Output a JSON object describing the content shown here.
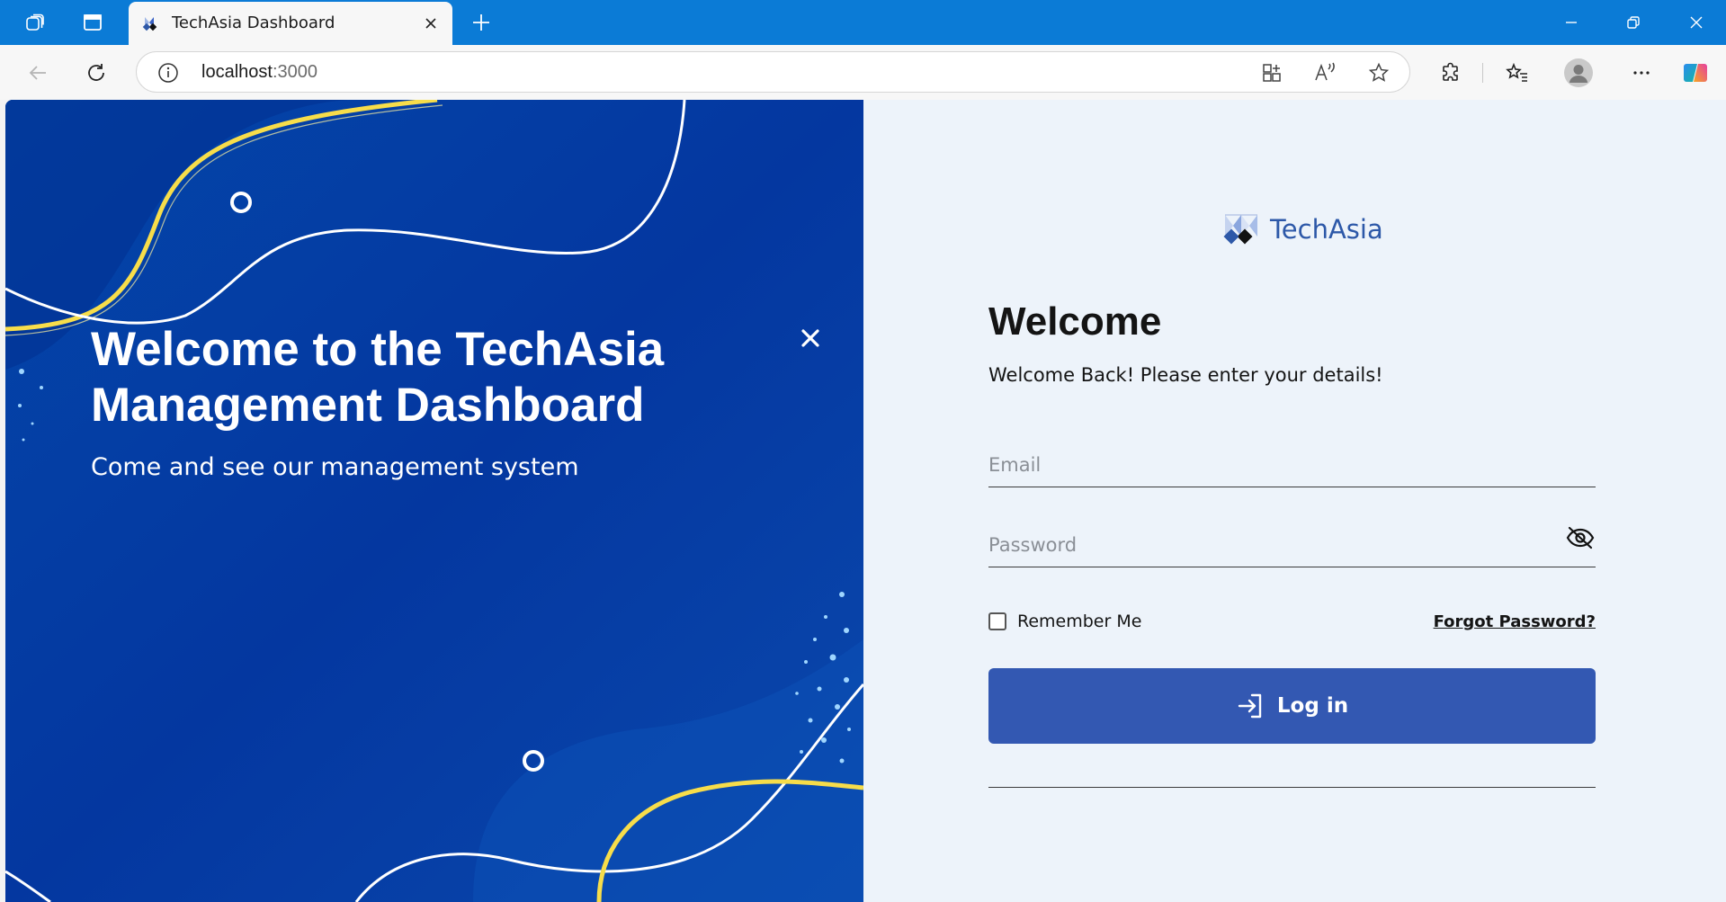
{
  "browser": {
    "tab": {
      "title": "TechAsia Dashboard"
    },
    "address": {
      "host": "localhost",
      "port": ":3000"
    }
  },
  "hero": {
    "title_line1": "Welcome to the TechAsia",
    "title_line2": "Management Dashboard",
    "subtitle": "Come and see our management system"
  },
  "login": {
    "brand": "TechAsia",
    "heading": "Welcome",
    "subheading": "Welcome Back! Please enter your details!",
    "email_placeholder": "Email",
    "password_placeholder": "Password",
    "remember_label": "Remember Me",
    "forgot_label": "Forgot Password?",
    "submit_label": "Log in"
  },
  "colors": {
    "browser_accent": "#0b7bd6",
    "hero_bg": "#053a99",
    "panel_bg": "#edf3fa",
    "brand_text": "#2d58a8",
    "button_bg": "#3358b2",
    "accent_yellow": "#f7dd4a"
  },
  "icons": {
    "tab_actions": "tab-actions-icon",
    "vertical_tabs": "vertical-tabs-icon",
    "info": "info-icon",
    "eye": "eye-off-icon",
    "login": "login-arrow-icon"
  }
}
